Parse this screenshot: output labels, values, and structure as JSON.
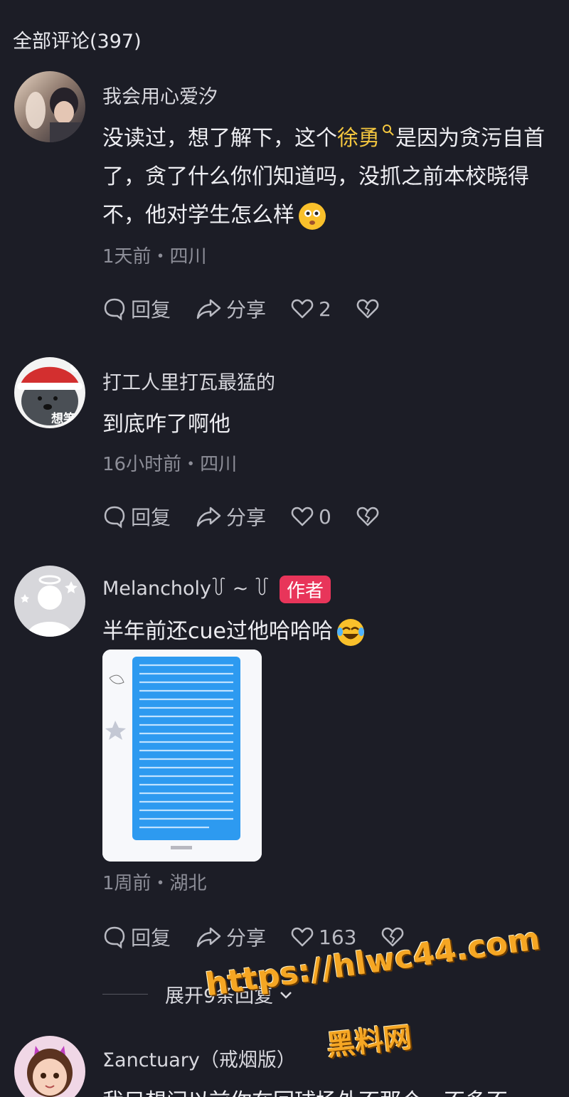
{
  "top_fragment": {
    "prefix": "…",
    "highlight": ""
  },
  "comments_header": "全部评论(397)",
  "comments": [
    {
      "username": "我会用心爱汐",
      "content_before": "没读过，想了解下，这个",
      "content_link": "徐勇",
      "content_after": "是因为贪污自首了，贪了什么你们知道吗，没抓之前本校晓得不，他对学生怎么样",
      "emoji": "😳",
      "meta": "1天前・四川",
      "reply_label": "回复",
      "share_label": "分享",
      "like_count": "2"
    },
    {
      "username": "打工人里打瓦最猛的",
      "content": "到底咋了啊他",
      "meta": "16小时前・四川",
      "reply_label": "回复",
      "share_label": "分享",
      "like_count": "0",
      "avatar_text": "想笑"
    },
    {
      "username": "Melancholy꒦ ~ ꒦",
      "author_badge": "作者",
      "content": "半年前还cue过他哈哈哈",
      "emoji": "😂",
      "meta": "1周前・湖北",
      "reply_label": "回复",
      "share_label": "分享",
      "like_count": "163"
    },
    {
      "username": "Σanctuary（戒烟版）",
      "content": "我只想问以前你在回球场外不那个…不多不"
    }
  ],
  "expand_replies_label": "展开9条回复",
  "watermark": {
    "url": "https://hlwc44.com",
    "name": "黑料网"
  },
  "colors": {
    "background": "#1c1d26",
    "link": "#f3c63f",
    "author_badge": "#e8355a",
    "watermark": "#f5a623"
  }
}
